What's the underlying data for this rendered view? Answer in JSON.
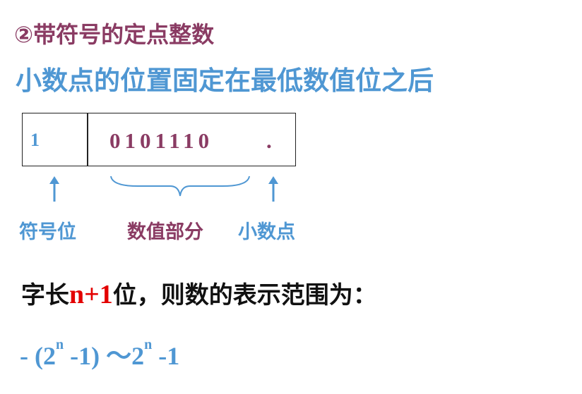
{
  "title": "②带符号的定点整数",
  "subtitle": "小数点的位置固定在最低数值位之后",
  "register": {
    "sign_bit": "1",
    "magnitude_bits": "0101110",
    "point": "."
  },
  "labels": {
    "sign": "符号位",
    "magnitude": "数值部分",
    "point": "小数点"
  },
  "range": {
    "prefix": "字长",
    "highlight": "n+1",
    "suffix": "位，则数的表示范围为："
  },
  "formula": {
    "part1": "- (2",
    "exp1": "n",
    "part2": " -1) ～2",
    "exp2": "n",
    "part3": " -1"
  },
  "colors": {
    "title": "#8a3b63",
    "accent_blue": "#4f97d3",
    "highlight_red": "#e30000"
  }
}
